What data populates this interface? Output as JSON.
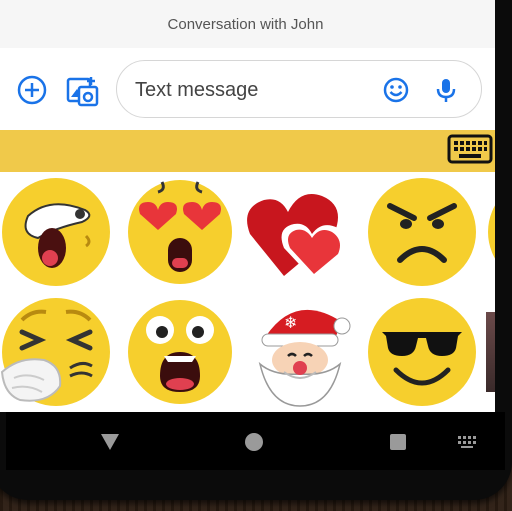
{
  "conversation": {
    "title": "Conversation with John"
  },
  "compose": {
    "placeholder": "Text message",
    "add_icon": "plus-circle-icon",
    "gallery_icon": "image-add-icon",
    "emoji_icon": "smiley-icon",
    "mic_icon": "microphone-icon"
  },
  "sticker_strip": {
    "keyboard_icon": "keyboard-icon"
  },
  "stickers": [
    {
      "name": "sticker-yawning-face"
    },
    {
      "name": "sticker-heart-eyes-surprised"
    },
    {
      "name": "sticker-two-hearts"
    },
    {
      "name": "sticker-angry-face"
    },
    {
      "name": "sticker-sneezing-face"
    },
    {
      "name": "sticker-shocked-face"
    },
    {
      "name": "sticker-santa-claus"
    },
    {
      "name": "sticker-sunglasses-face"
    }
  ],
  "nav": {
    "back_icon": "back-triangle-icon",
    "home_icon": "home-circle-icon",
    "recents_icon": "recents-square-icon",
    "keyboard_icon": "keyboard-small-icon"
  },
  "colors": {
    "accent": "#1a73e8",
    "strip": "#f0c94a",
    "emoji_yellow": "#f6cf2d"
  }
}
